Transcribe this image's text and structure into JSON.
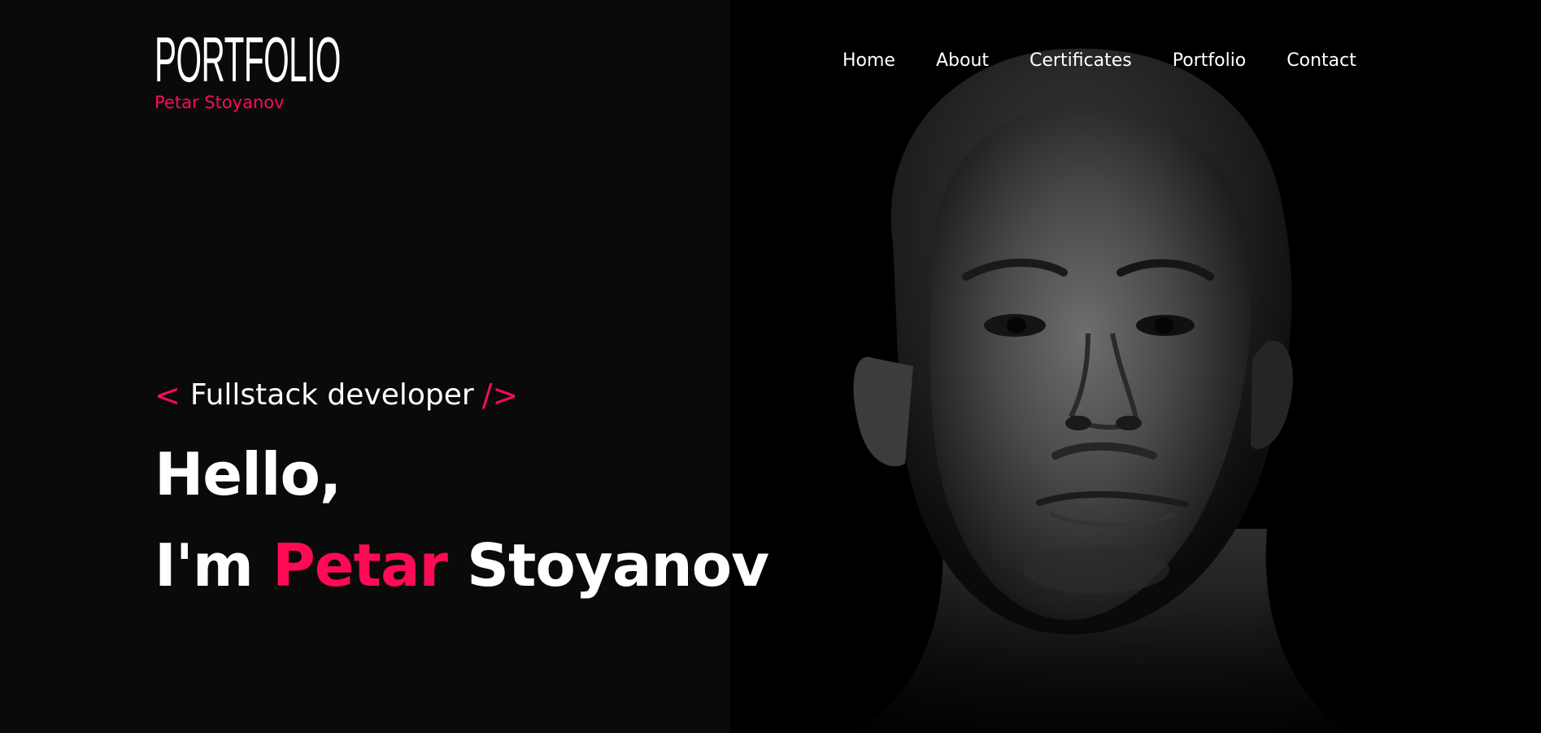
{
  "logo": {
    "title": "PORTFOLIO",
    "subtitle": "Petar Stoyanov"
  },
  "nav": {
    "items": [
      {
        "label": "Home"
      },
      {
        "label": "About"
      },
      {
        "label": "Certificates"
      },
      {
        "label": "Portfolio"
      },
      {
        "label": "Contact"
      }
    ]
  },
  "hero": {
    "bracket_open": "<",
    "role": "Fullstack developer",
    "bracket_close": "/>",
    "greeting": "Hello,",
    "intro_prefix": "I'm",
    "first_name": "Petar",
    "last_name": "Stoyanov"
  },
  "colors": {
    "background": "#0a0a0b",
    "accent": "#ff0a54",
    "text": "#ffffff"
  }
}
